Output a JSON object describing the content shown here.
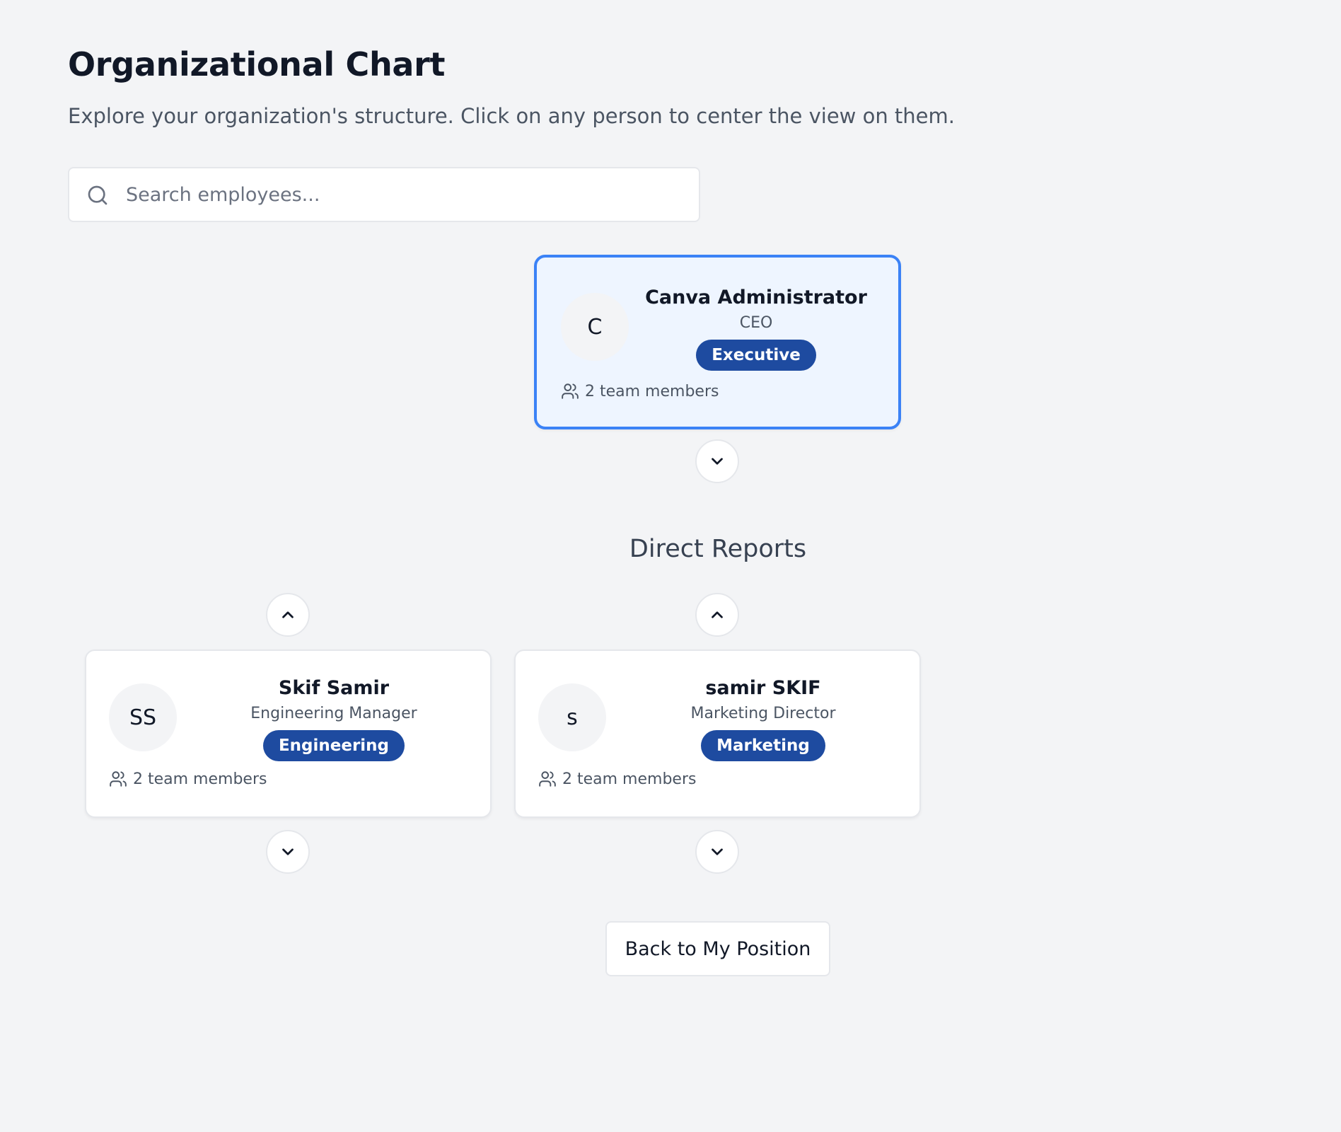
{
  "header": {
    "title": "Organizational Chart",
    "subtitle": "Explore your organization's structure. Click on any person to center the view on them."
  },
  "search": {
    "placeholder": "Search employees...",
    "value": "",
    "icon": "search-icon"
  },
  "selected_person": {
    "initials": "C",
    "name": "Canva Administrator",
    "role": "CEO",
    "department": "Executive",
    "team_count": "2 team members"
  },
  "direct_reports": {
    "title": "Direct Reports",
    "people": [
      {
        "initials": "SS",
        "name": "Skif Samir",
        "role": "Engineering Manager",
        "department": "Engineering",
        "team_count": "2 team members"
      },
      {
        "initials": "s",
        "name": "samir SKIF",
        "role": "Marketing Director",
        "department": "Marketing",
        "team_count": "2 team members"
      }
    ]
  },
  "actions": {
    "back_label": "Back to My Position"
  },
  "colors": {
    "background": "#f3f4f6",
    "selected_border": "#3b82f6",
    "selected_background": "#eef5ff",
    "badge": "#1e4ba0"
  }
}
